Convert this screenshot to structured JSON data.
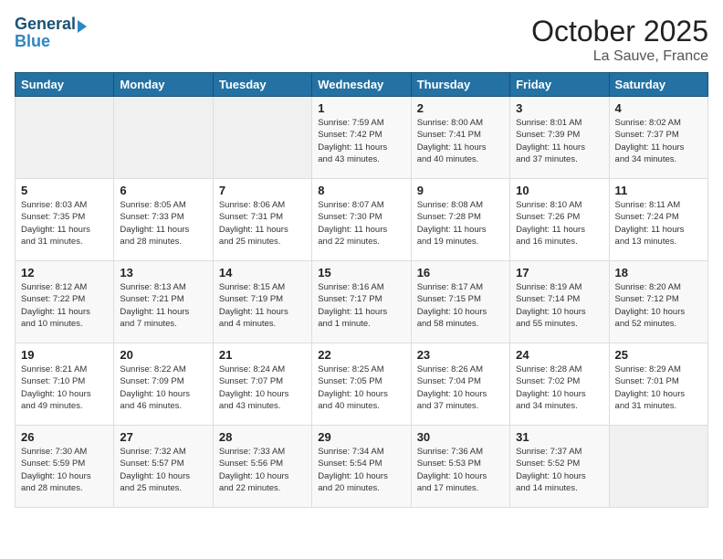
{
  "header": {
    "logo_line1": "General",
    "logo_line2": "Blue",
    "month": "October 2025",
    "location": "La Sauve, France"
  },
  "weekdays": [
    "Sunday",
    "Monday",
    "Tuesday",
    "Wednesday",
    "Thursday",
    "Friday",
    "Saturday"
  ],
  "weeks": [
    [
      {
        "num": "",
        "info": ""
      },
      {
        "num": "",
        "info": ""
      },
      {
        "num": "",
        "info": ""
      },
      {
        "num": "1",
        "info": "Sunrise: 7:59 AM\nSunset: 7:42 PM\nDaylight: 11 hours\nand 43 minutes."
      },
      {
        "num": "2",
        "info": "Sunrise: 8:00 AM\nSunset: 7:41 PM\nDaylight: 11 hours\nand 40 minutes."
      },
      {
        "num": "3",
        "info": "Sunrise: 8:01 AM\nSunset: 7:39 PM\nDaylight: 11 hours\nand 37 minutes."
      },
      {
        "num": "4",
        "info": "Sunrise: 8:02 AM\nSunset: 7:37 PM\nDaylight: 11 hours\nand 34 minutes."
      }
    ],
    [
      {
        "num": "5",
        "info": "Sunrise: 8:03 AM\nSunset: 7:35 PM\nDaylight: 11 hours\nand 31 minutes."
      },
      {
        "num": "6",
        "info": "Sunrise: 8:05 AM\nSunset: 7:33 PM\nDaylight: 11 hours\nand 28 minutes."
      },
      {
        "num": "7",
        "info": "Sunrise: 8:06 AM\nSunset: 7:31 PM\nDaylight: 11 hours\nand 25 minutes."
      },
      {
        "num": "8",
        "info": "Sunrise: 8:07 AM\nSunset: 7:30 PM\nDaylight: 11 hours\nand 22 minutes."
      },
      {
        "num": "9",
        "info": "Sunrise: 8:08 AM\nSunset: 7:28 PM\nDaylight: 11 hours\nand 19 minutes."
      },
      {
        "num": "10",
        "info": "Sunrise: 8:10 AM\nSunset: 7:26 PM\nDaylight: 11 hours\nand 16 minutes."
      },
      {
        "num": "11",
        "info": "Sunrise: 8:11 AM\nSunset: 7:24 PM\nDaylight: 11 hours\nand 13 minutes."
      }
    ],
    [
      {
        "num": "12",
        "info": "Sunrise: 8:12 AM\nSunset: 7:22 PM\nDaylight: 11 hours\nand 10 minutes."
      },
      {
        "num": "13",
        "info": "Sunrise: 8:13 AM\nSunset: 7:21 PM\nDaylight: 11 hours\nand 7 minutes."
      },
      {
        "num": "14",
        "info": "Sunrise: 8:15 AM\nSunset: 7:19 PM\nDaylight: 11 hours\nand 4 minutes."
      },
      {
        "num": "15",
        "info": "Sunrise: 8:16 AM\nSunset: 7:17 PM\nDaylight: 11 hours\nand 1 minute."
      },
      {
        "num": "16",
        "info": "Sunrise: 8:17 AM\nSunset: 7:15 PM\nDaylight: 10 hours\nand 58 minutes."
      },
      {
        "num": "17",
        "info": "Sunrise: 8:19 AM\nSunset: 7:14 PM\nDaylight: 10 hours\nand 55 minutes."
      },
      {
        "num": "18",
        "info": "Sunrise: 8:20 AM\nSunset: 7:12 PM\nDaylight: 10 hours\nand 52 minutes."
      }
    ],
    [
      {
        "num": "19",
        "info": "Sunrise: 8:21 AM\nSunset: 7:10 PM\nDaylight: 10 hours\nand 49 minutes."
      },
      {
        "num": "20",
        "info": "Sunrise: 8:22 AM\nSunset: 7:09 PM\nDaylight: 10 hours\nand 46 minutes."
      },
      {
        "num": "21",
        "info": "Sunrise: 8:24 AM\nSunset: 7:07 PM\nDaylight: 10 hours\nand 43 minutes."
      },
      {
        "num": "22",
        "info": "Sunrise: 8:25 AM\nSunset: 7:05 PM\nDaylight: 10 hours\nand 40 minutes."
      },
      {
        "num": "23",
        "info": "Sunrise: 8:26 AM\nSunset: 7:04 PM\nDaylight: 10 hours\nand 37 minutes."
      },
      {
        "num": "24",
        "info": "Sunrise: 8:28 AM\nSunset: 7:02 PM\nDaylight: 10 hours\nand 34 minutes."
      },
      {
        "num": "25",
        "info": "Sunrise: 8:29 AM\nSunset: 7:01 PM\nDaylight: 10 hours\nand 31 minutes."
      }
    ],
    [
      {
        "num": "26",
        "info": "Sunrise: 7:30 AM\nSunset: 5:59 PM\nDaylight: 10 hours\nand 28 minutes."
      },
      {
        "num": "27",
        "info": "Sunrise: 7:32 AM\nSunset: 5:57 PM\nDaylight: 10 hours\nand 25 minutes."
      },
      {
        "num": "28",
        "info": "Sunrise: 7:33 AM\nSunset: 5:56 PM\nDaylight: 10 hours\nand 22 minutes."
      },
      {
        "num": "29",
        "info": "Sunrise: 7:34 AM\nSunset: 5:54 PM\nDaylight: 10 hours\nand 20 minutes."
      },
      {
        "num": "30",
        "info": "Sunrise: 7:36 AM\nSunset: 5:53 PM\nDaylight: 10 hours\nand 17 minutes."
      },
      {
        "num": "31",
        "info": "Sunrise: 7:37 AM\nSunset: 5:52 PM\nDaylight: 10 hours\nand 14 minutes."
      },
      {
        "num": "",
        "info": ""
      }
    ]
  ]
}
